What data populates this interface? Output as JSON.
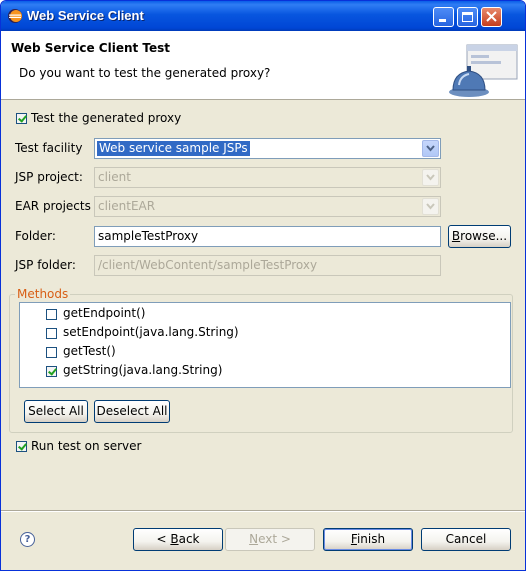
{
  "window": {
    "title": "Web Service Client"
  },
  "header": {
    "title": "Web Service Client Test",
    "description": "Do you want to test the generated proxy?"
  },
  "test_proxy": {
    "label": "Test the generated proxy",
    "checked": true
  },
  "form": {
    "test_facility": {
      "label": "Test facility",
      "value": "Web service sample JSPs"
    },
    "jsp_project": {
      "label": "JSP project:",
      "value": "client"
    },
    "ear_projects": {
      "label": "EAR projects",
      "value": "clientEAR"
    },
    "folder": {
      "label": "Folder:",
      "value": "sampleTestProxy",
      "browse_label_pre": "",
      "browse_mnemonic": "B",
      "browse_label_post": "rowse..."
    },
    "jsp_folder": {
      "label": "JSP folder:",
      "value": "/client/WebContent/sampleTestProxy"
    }
  },
  "methods": {
    "legend": "Methods",
    "items": [
      {
        "label": "getEndpoint()",
        "checked": false
      },
      {
        "label": "setEndpoint(java.lang.String)",
        "checked": false
      },
      {
        "label": "getTest()",
        "checked": false
      },
      {
        "label": "getString(java.lang.String)",
        "checked": true
      }
    ],
    "select_all": "Select All",
    "deselect_all": "Deselect All"
  },
  "run_test": {
    "label": "Run test on server",
    "checked": true
  },
  "footer": {
    "help": "?",
    "back_pre": "< ",
    "back_mnemonic": "B",
    "back_post": "ack",
    "next_mnemonic": "N",
    "next_post": "ext >",
    "finish_mnemonic": "F",
    "finish_post": "inish",
    "cancel": "Cancel"
  },
  "colors": {
    "title_bar": "#0054e3",
    "dialog_bg": "#ece9d8",
    "selection": "#316ac5",
    "group_legend": "#d85f16"
  }
}
